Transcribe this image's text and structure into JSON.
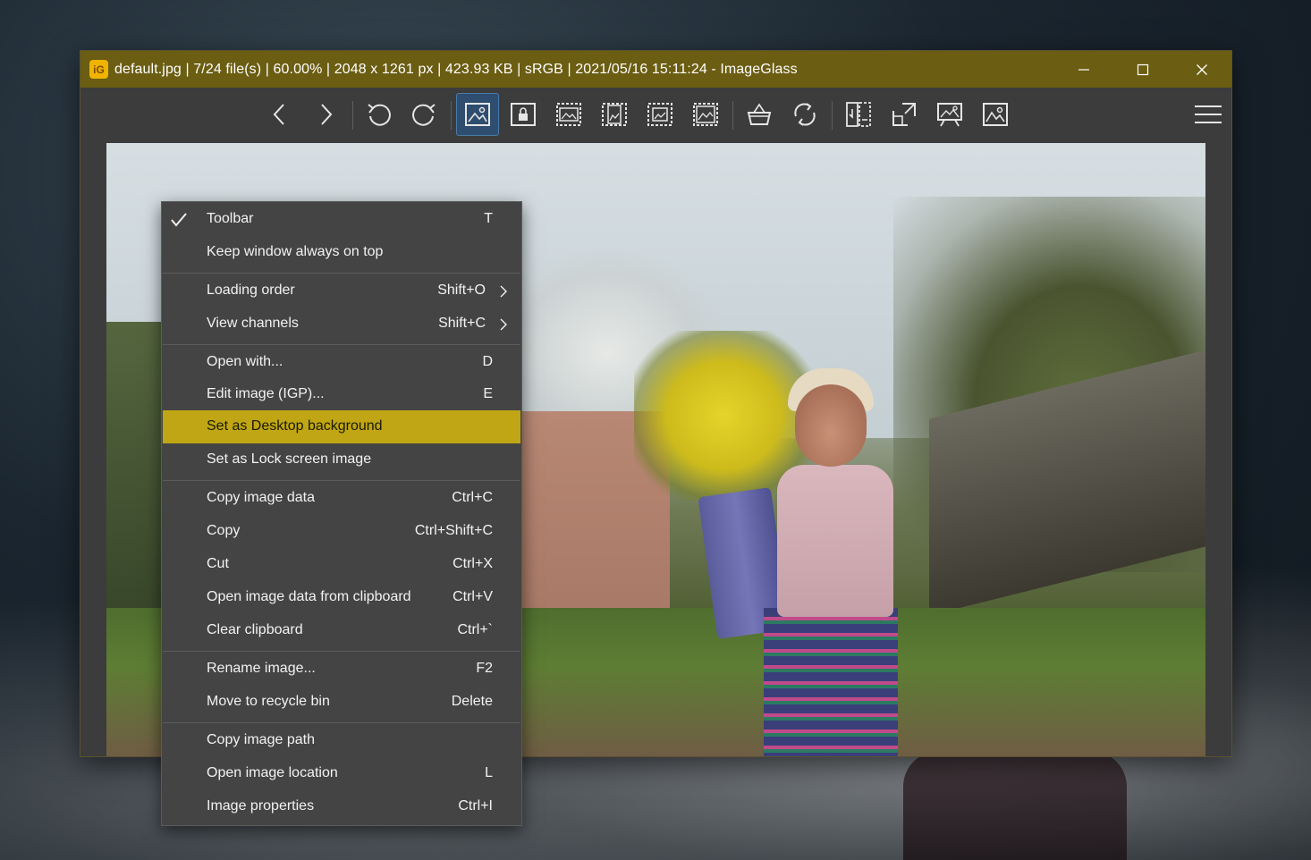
{
  "window": {
    "title_parts": {
      "filename": "default.jpg",
      "file_index": "7/24 file(s)",
      "zoom": "60.00%",
      "dimensions": "2048 x 1261 px",
      "size": "423.93 KB",
      "color_space": "sRGB",
      "datetime": "2021/05/16 15:11:24",
      "app_name": "ImageGlass"
    },
    "title_full": "default.jpg  |  7/24 file(s)  |  60.00%  |  2048 x 1261 px  |  423.93 KB  |  sRGB  |  2021/05/16 15:11:24  - ImageGlass",
    "app_icon_glyph": "iG",
    "accent_color": "#6b5d12",
    "highlight_color": "#c0a614"
  },
  "toolbar": {
    "buttons": [
      {
        "icon": "chevron-left-icon",
        "tooltip": "View previous image"
      },
      {
        "icon": "chevron-right-icon",
        "tooltip": "View next image"
      },
      {
        "icon": "rotate-left-icon",
        "tooltip": "Rotate left"
      },
      {
        "icon": "rotate-right-icon",
        "tooltip": "Rotate right"
      },
      {
        "icon": "auto-zoom-icon",
        "tooltip": "Auto zoom",
        "active": true
      },
      {
        "icon": "lock-zoom-icon",
        "tooltip": "Lock zoom ratio"
      },
      {
        "icon": "scale-to-width-icon",
        "tooltip": "Scale to width"
      },
      {
        "icon": "scale-to-height-icon",
        "tooltip": "Scale to height"
      },
      {
        "icon": "scale-to-fit-icon",
        "tooltip": "Scale to fit"
      },
      {
        "icon": "scale-to-fill-icon",
        "tooltip": "Scale to fill"
      },
      {
        "icon": "basket-icon",
        "tooltip": "Adjust window size"
      },
      {
        "icon": "refresh-icon",
        "tooltip": "Refresh"
      },
      {
        "icon": "open-icon",
        "tooltip": "Open"
      },
      {
        "icon": "fullscreen-icon",
        "tooltip": "Full screen"
      },
      {
        "icon": "slideshow-icon",
        "tooltip": "Slideshow"
      },
      {
        "icon": "view-image-icon",
        "tooltip": "Viewer"
      }
    ],
    "menu_icon": "hamburger-menu-icon"
  },
  "context_menu": {
    "items": [
      {
        "label": "Toolbar",
        "shortcut": "T",
        "checked": true
      },
      {
        "label": "Keep window always on top",
        "shortcut": ""
      },
      {
        "label": "Loading order",
        "shortcut": "Shift+O",
        "submenu": true
      },
      {
        "label": "View channels",
        "shortcut": "Shift+C",
        "submenu": true
      },
      {
        "label": "Open with...",
        "shortcut": "D"
      },
      {
        "label": "Edit image (IGP)...",
        "shortcut": "E"
      },
      {
        "label": "Set as Desktop background",
        "shortcut": "",
        "highlighted": true
      },
      {
        "label": "Set as Lock screen image",
        "shortcut": ""
      },
      {
        "label": "Copy image data",
        "shortcut": "Ctrl+C"
      },
      {
        "label": "Copy",
        "shortcut": "Ctrl+Shift+C"
      },
      {
        "label": "Cut",
        "shortcut": "Ctrl+X"
      },
      {
        "label": "Open image data from clipboard",
        "shortcut": "Ctrl+V"
      },
      {
        "label": "Clear clipboard",
        "shortcut": "Ctrl+`"
      },
      {
        "label": "Rename image...",
        "shortcut": "F2"
      },
      {
        "label": "Move to recycle bin",
        "shortcut": "Delete"
      },
      {
        "label": "Copy image path",
        "shortcut": ""
      },
      {
        "label": "Open image location",
        "shortcut": "L"
      },
      {
        "label": "Image properties",
        "shortcut": "Ctrl+I"
      }
    ]
  }
}
